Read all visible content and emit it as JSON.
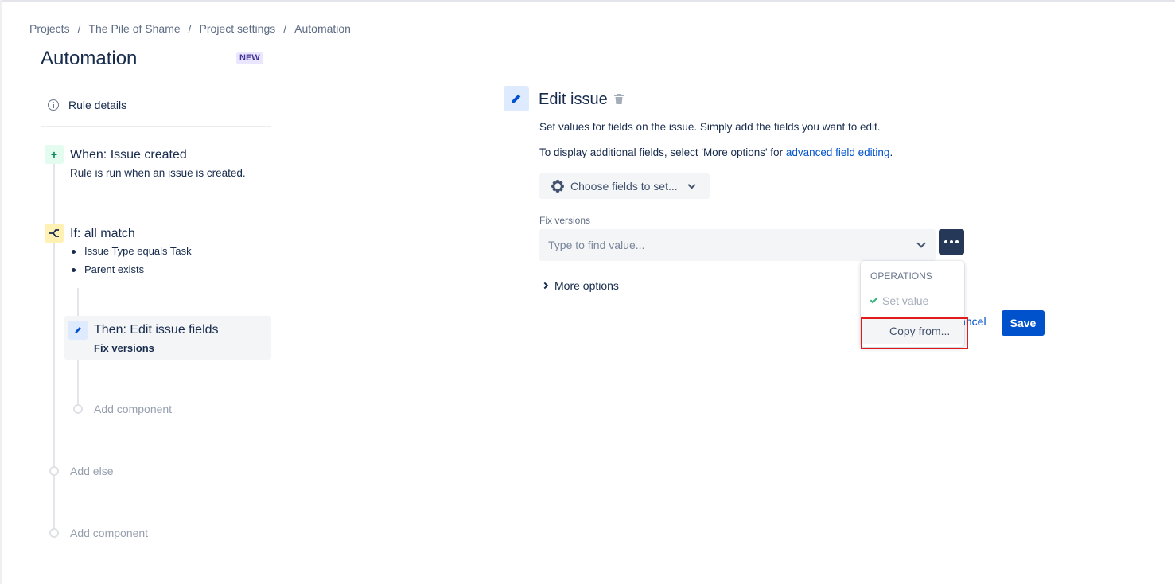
{
  "breadcrumb": {
    "items": [
      "Projects",
      "The Pile of Shame",
      "Project settings",
      "Automation"
    ],
    "separator": "/"
  },
  "page": {
    "title": "Automation",
    "badge": "NEW"
  },
  "sidebar": {
    "rule_details_label": "Rule details",
    "trigger": {
      "title": "When: Issue created",
      "subtitle": "Rule is run when an issue is created.",
      "icon": "plus-icon"
    },
    "condition": {
      "title": "If: all match",
      "icon": "branch-icon",
      "items": [
        "Issue Type equals Task",
        "Parent exists"
      ]
    },
    "action": {
      "title": "Then: Edit issue fields",
      "subtitle": "Fix versions",
      "icon": "pencil-icon"
    },
    "add_component_inner": "Add component",
    "add_else": "Add else",
    "add_component_outer": "Add component"
  },
  "editor": {
    "title": "Edit issue",
    "description": "Set values for fields on the issue. Simply add the fields you want to edit.",
    "additional_prefix": "To display additional fields, select 'More options' for ",
    "additional_link": "advanced field editing",
    "additional_suffix": ".",
    "choose_fields_label": "Choose fields to set...",
    "field": {
      "label": "Fix versions",
      "placeholder": "Type to find value..."
    },
    "more_options_label": "More options",
    "cancel_label": "Cancel",
    "save_label": "Save"
  },
  "operations_menu": {
    "heading": "OPERATIONS",
    "items": [
      {
        "label": "Set value",
        "selected": true
      },
      {
        "label": "Copy from...",
        "selected": false,
        "highlighted": true
      }
    ]
  },
  "colors": {
    "primary": "#0052cc",
    "text": "#172b4d",
    "highlight_box": "#e01b1b",
    "more_button": "#253858"
  }
}
